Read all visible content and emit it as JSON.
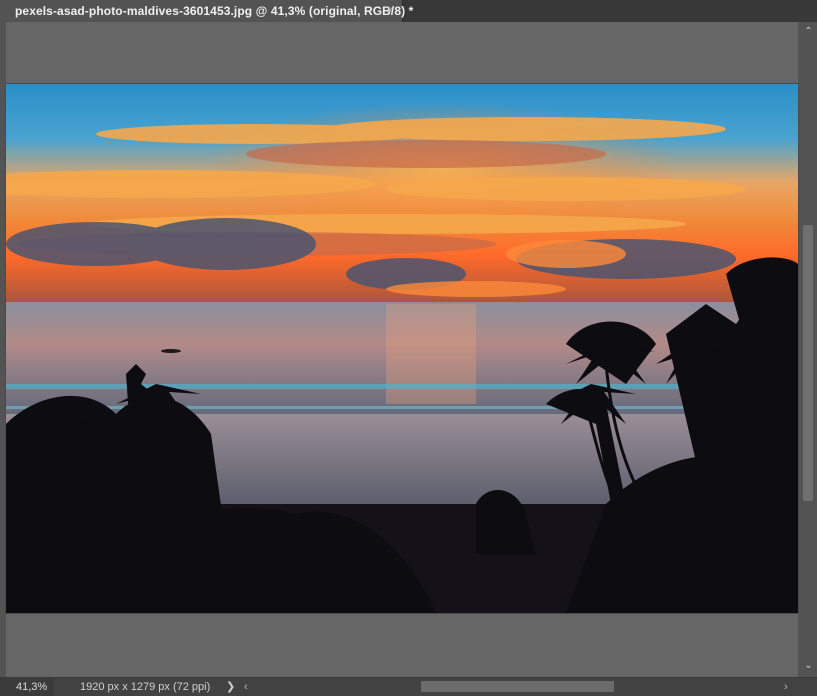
{
  "document_tab": {
    "title": "pexels-asad-photo-maldives-3601453.jpg @ 41,3% (original, RGB/8) *",
    "close_glyph": "×"
  },
  "scrollbars": {
    "up_glyph": "⌃",
    "down_glyph": "⌄",
    "left_glyph": "‹",
    "right_glyph": "›"
  },
  "status_bar": {
    "zoom": "41,3%",
    "document_info": "1920 px x 1279 px (72 ppi)",
    "menu_arrow": "❯"
  },
  "colors": {
    "workspace_bg": "#535353",
    "canvas_bg": "#666666",
    "tab_active": "#535353",
    "tab_bar": "#383838",
    "status_bg": "#424242"
  },
  "image_icon": "sunset-beach-photo"
}
